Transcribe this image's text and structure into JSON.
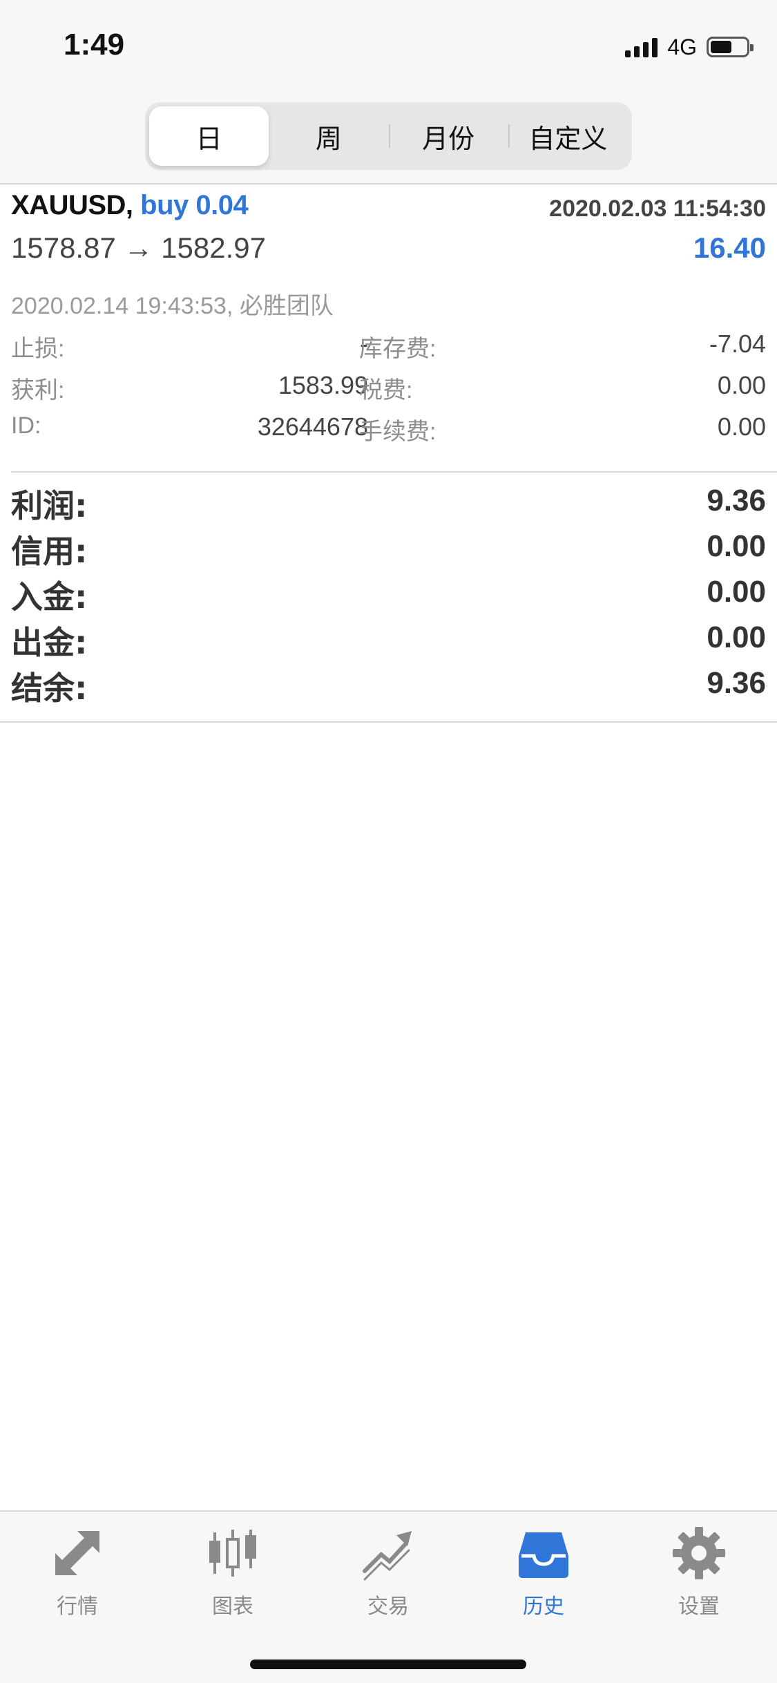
{
  "status_bar": {
    "time": "1:49",
    "network": "4G",
    "battery_level": 0.6
  },
  "period_tabs": [
    {
      "label": "日",
      "active": true
    },
    {
      "label": "周",
      "active": false
    },
    {
      "label": "月份",
      "active": false
    },
    {
      "label": "自定义",
      "active": false
    }
  ],
  "trade": {
    "symbol": "XAUUSD,",
    "side_volume": "buy 0.04",
    "open_time": "2020.02.03 11:54:30",
    "price_range": "1578.87 → 1582.97",
    "profit": "16.40",
    "close_info": "2020.02.14 19:43:53, 必胜团队",
    "details": [
      {
        "left_label": "止损:",
        "left_value": "-",
        "right_label": "库存费:",
        "right_value": "-7.04"
      },
      {
        "left_label": "获利:",
        "left_value": "1583.99",
        "right_label": "税费:",
        "right_value": "0.00"
      },
      {
        "left_label": "ID:",
        "left_value": "32644678",
        "right_label": "手续费:",
        "right_value": "0.00"
      }
    ]
  },
  "summary": [
    {
      "label": "利润:",
      "value": "9.36"
    },
    {
      "label": "信用:",
      "value": "0.00"
    },
    {
      "label": "入金:",
      "value": "0.00"
    },
    {
      "label": "出金:",
      "value": "0.00"
    },
    {
      "label": "结余:",
      "value": "9.36"
    }
  ],
  "tabbar": [
    {
      "label": "行情",
      "icon": "quotes-arrows-icon",
      "active": false
    },
    {
      "label": "图表",
      "icon": "candlestick-chart-icon",
      "active": false
    },
    {
      "label": "交易",
      "icon": "trade-trend-icon",
      "active": false
    },
    {
      "label": "历史",
      "icon": "history-inbox-icon",
      "active": true
    },
    {
      "label": "设置",
      "icon": "gear-icon",
      "active": false
    }
  ],
  "colors": {
    "accent": "#2f76d8",
    "inactive_icon": "#8a8a8a",
    "text_dark": "#333333",
    "text_muted": "#8d8d8d"
  }
}
